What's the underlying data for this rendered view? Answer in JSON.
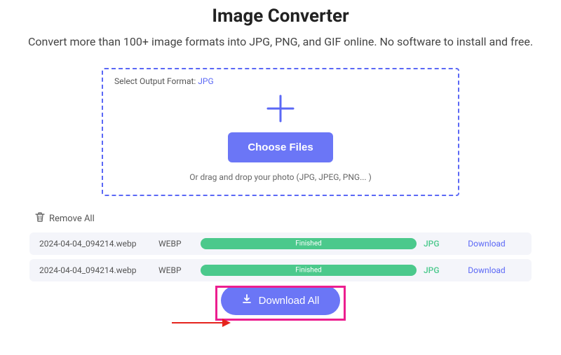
{
  "header": {
    "title": "Image Converter",
    "subtitle": "Convert more than 100+ image formats into JPG, PNG, and GIF online. No software to install and free."
  },
  "uploadBox": {
    "outputFormatLabel": "Select Output Format: ",
    "outputFormatValue": "JPG",
    "chooseFilesLabel": "Choose Files",
    "dragHint": "Or drag and drop your photo (JPG, JPEG, PNG... )"
  },
  "removeAllLabel": "Remove All",
  "files": [
    {
      "name": "2024-04-04_094214.webp",
      "typeIn": "WEBP",
      "status": "Finished",
      "typeOut": "JPG",
      "downloadLabel": "Download"
    },
    {
      "name": "2024-04-04_094214.webp",
      "typeIn": "WEBP",
      "status": "Finished",
      "typeOut": "JPG",
      "downloadLabel": "Download"
    }
  ],
  "downloadAllLabel": "Download All"
}
